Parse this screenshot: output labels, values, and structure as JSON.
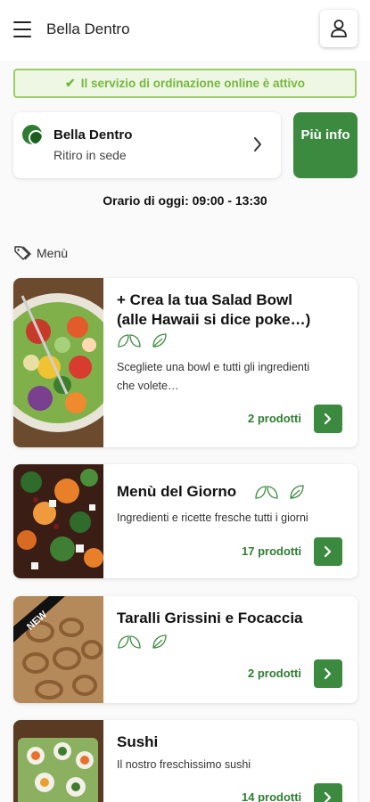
{
  "header": {
    "title": "Bella Dentro",
    "menu_icon": "hamburger-icon",
    "user_icon": "user-icon"
  },
  "banner": {
    "text": "Il servizio di ordinazione online è attivo",
    "icon": "check-icon"
  },
  "store": {
    "name": "Bella Dentro",
    "mode": "Ritiro in sede"
  },
  "more_info": {
    "label": "Più info",
    "icon": "info-icon"
  },
  "hours": "Orario di oggi: 09:00 - 13:30",
  "menu": {
    "heading": "Menù",
    "icon": "tag-icon"
  },
  "colors": {
    "accent": "#3c8a3f",
    "banner_border": "#9bd065",
    "banner_text": "#76b83e"
  },
  "categories": [
    {
      "title_line1": "+ Crea la tua Salad Bowl",
      "title_line2": "(alle Hawaii si dice poke…)",
      "description_line1": "Scegliete una bowl e tutti gli ingredienti",
      "description_line2": "che volete…",
      "count": "2 prodotti",
      "icons": [
        "vegan-icon",
        "vegetarian-icon"
      ]
    },
    {
      "title": "Menù del Giorno",
      "description": "Ingredienti e ricette fresche tutti i giorni",
      "count": "17 prodotti",
      "icons": [
        "vegan-icon",
        "vegetarian-icon"
      ]
    },
    {
      "title": "Taralli Grissini e Focaccia",
      "count": "2 prodotti",
      "icons": [
        "vegan-icon",
        "vegetarian-icon"
      ],
      "image_label": "NEW"
    },
    {
      "title": "Sushi",
      "description": "Il nostro freschissimo sushi",
      "count": "14 prodotti"
    }
  ]
}
